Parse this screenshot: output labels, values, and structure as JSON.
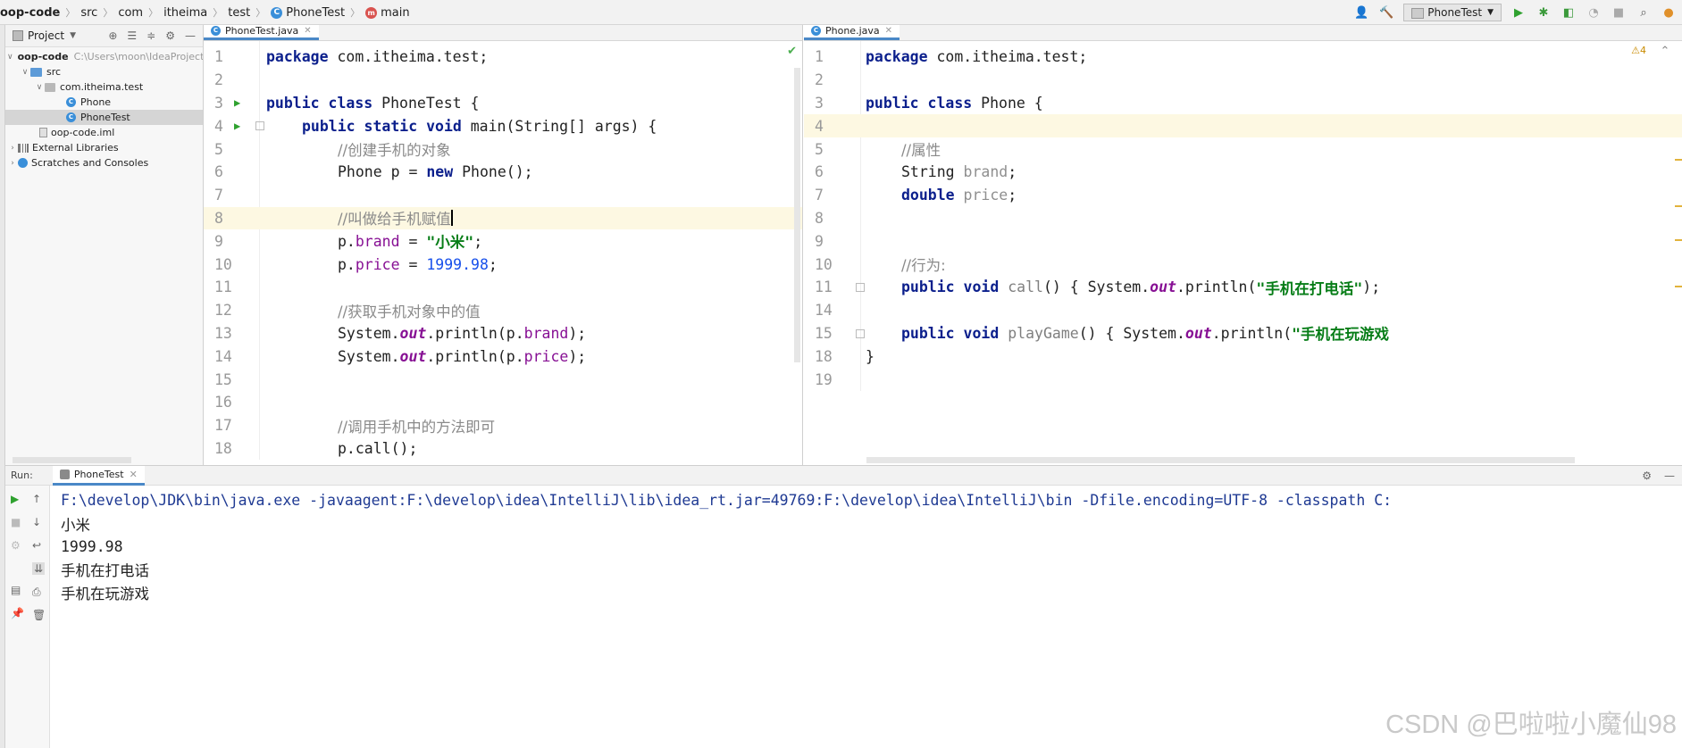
{
  "breadcrumb": {
    "project": "oop-code",
    "parts": [
      "src",
      "com",
      "itheima",
      "test"
    ],
    "class_name": "PhoneTest",
    "method_name": "main"
  },
  "toolbar": {
    "run_config": "PhoneTest"
  },
  "project_panel": {
    "title": "Project",
    "root": "oop-code",
    "root_path": "C:\\Users\\moon\\IdeaProjects",
    "src": "src",
    "package": "com.itheima.test",
    "files": [
      "Phone",
      "PhoneTest"
    ],
    "iml": "oop-code.iml",
    "external_libraries": "External Libraries",
    "scratches": "Scratches and Consoles"
  },
  "editor_left": {
    "tab": "PhoneTest.java",
    "line_numbers": [
      "1",
      "2",
      "3",
      "4",
      "5",
      "6",
      "7",
      "8",
      "9",
      "10",
      "11",
      "12",
      "13",
      "14",
      "15",
      "16",
      "17",
      "18"
    ],
    "lines": {
      "l1_kw": "package",
      "l1_rest": " com.itheima.test;",
      "l3_kw": "public class",
      "l3_rest": " PhoneTest {",
      "l4_kw": "public static void",
      "l4_rest": " main(String[] args) {",
      "l5_cmt": "//创建手机的对象",
      "l6_a": "Phone p = ",
      "l6_kw": "new",
      "l6_b": " Phone();",
      "l8_cmt": "//叫做给手机赋值",
      "l9_a": "p.",
      "l9_field": "brand",
      "l9_b": " = ",
      "l9_str": "\"小米\"",
      "l9_c": ";",
      "l10_a": "p.",
      "l10_field": "price",
      "l10_b": " = ",
      "l10_num": "1999.98",
      "l10_c": ";",
      "l12_cmt": "//获取手机对象中的值",
      "l13_a": "System.",
      "l13_out": "out",
      "l13_b": ".println(p.",
      "l13_field": "brand",
      "l13_c": ");",
      "l14_a": "System.",
      "l14_out": "out",
      "l14_b": ".println(p.",
      "l14_field": "price",
      "l14_c": ");",
      "l17_cmt": "//调用手机中的方法即可",
      "l18": "p.call();"
    }
  },
  "editor_right": {
    "tab": "Phone.java",
    "warning_count": "4",
    "line_numbers": [
      "1",
      "2",
      "3",
      "4",
      "5",
      "6",
      "7",
      "8",
      "9",
      "10",
      "11",
      "14",
      "15",
      "18",
      "19"
    ],
    "lines": {
      "l1_kw": "package",
      "l1_rest": " com.itheima.test;",
      "l3_kw": "public class",
      "l3_rest": " Phone {",
      "l5_cmt": "//属性",
      "l6_a": "String ",
      "l6_field": "brand",
      "l6_b": ";",
      "l7_kw": "double",
      "l7_sp": " ",
      "l7_field": "price",
      "l7_b": ";",
      "l10_cmt": "//行为:",
      "l11_kw": "public void",
      "l11_m": " call",
      "l11_a": "() { System.",
      "l11_out": "out",
      "l11_b": ".println(",
      "l11_str": "\"手机在打电话\"",
      "l11_c": ");",
      "l15_kw": "public void",
      "l15_m": " playGame",
      "l15_a": "() { System.",
      "l15_out": "out",
      "l15_b": ".println(",
      "l15_str": "\"手机在玩游戏",
      "l18": "}"
    }
  },
  "run_panel": {
    "label": "Run:",
    "tab": "PhoneTest",
    "command": "F:\\develop\\JDK\\bin\\java.exe -javaagent:F:\\develop\\idea\\IntelliJ\\lib\\idea_rt.jar=49769:F:\\develop\\idea\\IntelliJ\\bin -Dfile.encoding=UTF-8 -classpath C:",
    "output": [
      "小米",
      "1999.98",
      "手机在打电话",
      "手机在玩游戏"
    ]
  },
  "watermark": "CSDN @巴啦啦小魔仙98"
}
